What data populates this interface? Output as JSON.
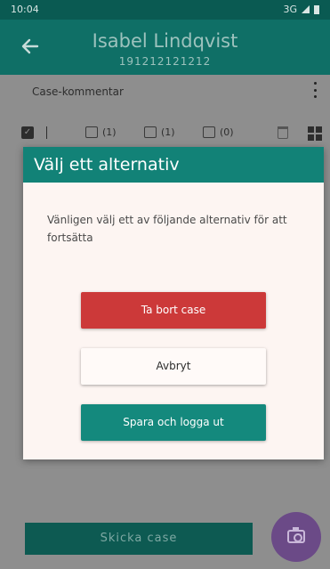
{
  "statusbar": {
    "time": "10:04",
    "network": "3G"
  },
  "header": {
    "name": "Isabel Lindqvist",
    "personal_number": "191212121212"
  },
  "content": {
    "comment_label": "Case-kommentar",
    "counts": {
      "documents": "(1)",
      "images": "(1)",
      "videos": "(0)"
    },
    "send_button": "Skicka case"
  },
  "dialog": {
    "title": "Välj ett alternativ",
    "message": "Vänligen välj ett av följande alternativ för att fortsätta",
    "delete_label": "Ta bort case",
    "cancel_label": "Avbryt",
    "save_logout_label": "Spara och logga ut"
  },
  "colors": {
    "primary": "#128277",
    "danger": "#cc3939",
    "fab": "#6b4a87"
  }
}
